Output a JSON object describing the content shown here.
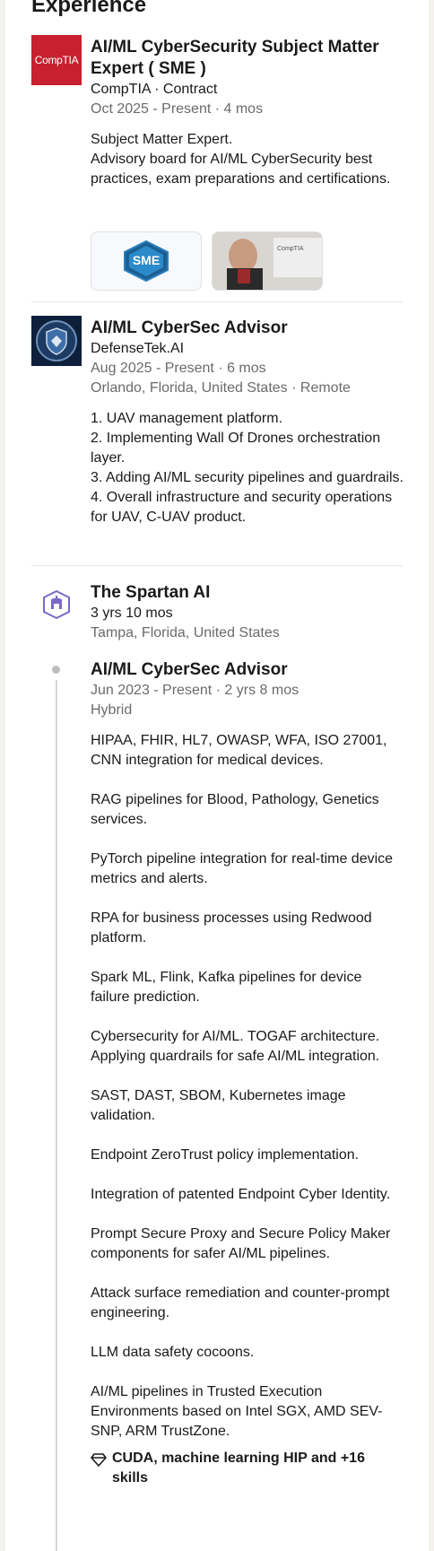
{
  "section": {
    "title": "Experience"
  },
  "entries": [
    {
      "logo_text": "CompTIA",
      "title": "AI/ML CyberSecurity Subject Matter Expert ( SME )",
      "company": "CompTIA · Contract",
      "dates": "Oct 2025 - Present · 4 mos",
      "description": [
        "Subject Matter Expert.",
        "Advisory board for AI/ML CyberSecurity best practices, exam preparations and certifications."
      ],
      "media": [
        {
          "icon": "sme-badge-icon",
          "badge_text": "SME"
        },
        {
          "icon": "person-photo",
          "caption": "CompTIA"
        }
      ]
    },
    {
      "title": "AI/ML CyberSec Advisor",
      "company": "DefenseTek.AI",
      "dates": "Aug 2025 - Present · 6 mos",
      "location": "Orlando, Florida, United States · Remote",
      "description": [
        "1. UAV management platform.",
        "2. Implementing Wall Of Drones orchestration layer.",
        "3. Adding AI/ML security pipelines and guardrails.",
        "4. Overall infrastructure and security operations for UAV, C-UAV product."
      ]
    }
  ],
  "group": {
    "company": "The Spartan AI",
    "duration": "3 yrs 10 mos",
    "location": "Tampa, Florida, United States",
    "role": {
      "title": "AI/ML CyberSec Advisor",
      "dates": "Jun 2023 - Present · 2 yrs 8 mos",
      "workplace": "Hybrid",
      "paragraphs": [
        "HIPAA, FHIR, HL7, OWASP, WFA, ISO 27001, CNN integration for medical devices.",
        "RAG pipelines for Blood, Pathology, Genetics services.",
        "PyTorch pipeline integration for real-time device metrics and alerts.",
        "RPA for business processes using Redwood platform.",
        "Spark ML, Flink, Kafka pipelines for device failure prediction.",
        "Cybersecurity for AI/ML. TOGAF architecture. Applying quardrails for safe AI/ML integration.",
        "SAST, DAST, SBOM, Kubernetes image validation.",
        "Endpoint ZeroTrust policy implementation.",
        "Integration of patented Endpoint Cyber Identity.",
        "Prompt Secure Proxy and Secure Policy Maker components for safer AI/ML pipelines.",
        "Attack surface remediation and counter-prompt engineering.",
        "LLM data safety cocoons.",
        "AI/ML pipelines in Trusted Execution Environments based on Intel SGX, AMD SEV-SNP, ARM TrustZone."
      ],
      "skills": "CUDA, machine learning HIP and +16 skills"
    }
  },
  "colors": {
    "comptia_red": "#c8202f",
    "muted_text": "#6b6b6b",
    "divider": "#e6e6e6"
  }
}
